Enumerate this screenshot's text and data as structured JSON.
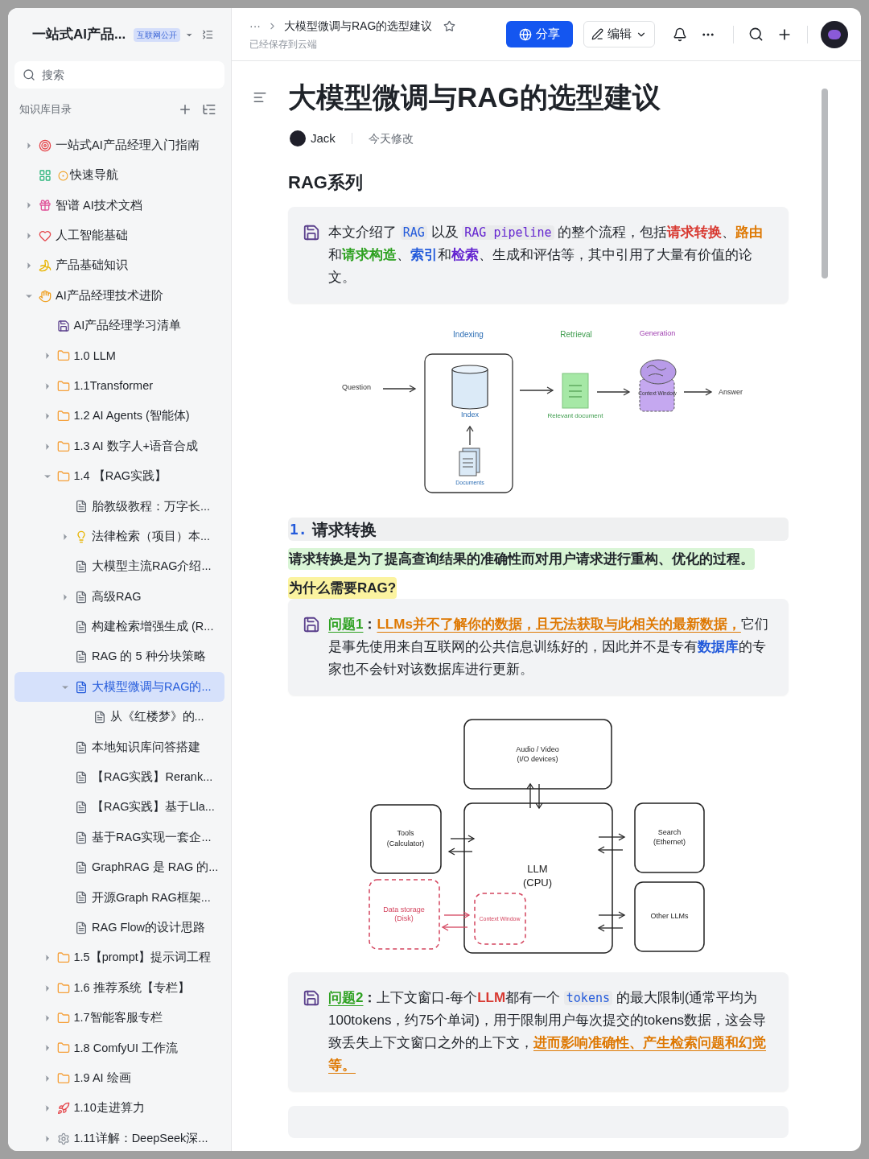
{
  "sidebar": {
    "space_title": "一站式AI产品...",
    "badge": "互联网公开",
    "search": {
      "placeholder": "搜索"
    },
    "section_label": "知识库目录",
    "items": [
      {
        "label": "一站式AI产品经理入门指南",
        "kind": "target",
        "expanded": false
      },
      {
        "label": "快速导航",
        "kind": "app",
        "prefix_icon": true
      },
      {
        "label": "智谱 AI技术文档",
        "kind": "gift",
        "expanded": false
      },
      {
        "label": "人工智能基础",
        "kind": "heart",
        "expanded": false
      },
      {
        "label": "产品基础知识",
        "kind": "banana",
        "expanded": false
      },
      {
        "label": "AI产品经理技术进阶",
        "kind": "hand",
        "expanded": true,
        "children": [
          {
            "label": "AI产品经理学习清单",
            "kind": "save"
          },
          {
            "label": "1.0 LLM",
            "kind": "folder",
            "expanded": false
          },
          {
            "label": "1.1Transformer",
            "kind": "folder",
            "expanded": false
          },
          {
            "label": "1.2 AI Agents (智能体)",
            "kind": "folder",
            "expanded": false
          },
          {
            "label": "1.3 AI 数字人+语音合成",
            "kind": "folder",
            "expanded": false
          },
          {
            "label": "1.4 【RAG实践】",
            "kind": "folder",
            "expanded": true,
            "children": [
              {
                "label": "胎教级教程：万字长...",
                "kind": "doc"
              },
              {
                "label": "法律检索（项目）本...",
                "kind": "bulb",
                "expanded": false
              },
              {
                "label": "大模型主流RAG介绍...",
                "kind": "doc"
              },
              {
                "label": "高级RAG",
                "kind": "doc",
                "expanded": false
              },
              {
                "label": "构建检索增强生成 (R...",
                "kind": "doc"
              },
              {
                "label": "RAG 的 5 种分块策略",
                "kind": "doc"
              },
              {
                "label": "大模型微调与RAG的...",
                "kind": "doc",
                "selected": true,
                "expanded": true,
                "children": [
                  {
                    "label": "从《红楼梦》的...",
                    "kind": "doc"
                  }
                ]
              },
              {
                "label": "本地知识库问答搭建",
                "kind": "doc"
              },
              {
                "label": "【RAG实践】Rerank...",
                "kind": "doc"
              },
              {
                "label": "【RAG实践】基于Lla...",
                "kind": "doc"
              },
              {
                "label": "基于RAG实现一套企...",
                "kind": "doc"
              },
              {
                "label": "GraphRAG 是 RAG 的...",
                "kind": "doc"
              },
              {
                "label": "开源Graph RAG框架...",
                "kind": "doc"
              },
              {
                "label": "RAG Flow的设计思路",
                "kind": "doc"
              }
            ]
          },
          {
            "label": "1.5【prompt】提示词工程",
            "kind": "folder",
            "expanded": false
          },
          {
            "label": "1.6 推荐系统【专栏】",
            "kind": "folder",
            "expanded": false
          },
          {
            "label": "1.7智能客服专栏",
            "kind": "folder",
            "expanded": false
          },
          {
            "label": "1.8 ComfyUI 工作流",
            "kind": "folder",
            "expanded": false
          },
          {
            "label": "1.9 AI 绘画",
            "kind": "folder",
            "expanded": false
          },
          {
            "label": "1.10走进算力",
            "kind": "rocket",
            "expanded": false
          },
          {
            "label": "1.11详解：DeepSeek深...",
            "kind": "gear",
            "expanded": false
          }
        ]
      }
    ]
  },
  "header": {
    "more": "···",
    "breadcrumb": "大模型微调与RAG的选型建议",
    "starred": false,
    "save_status": "已经保存到云端",
    "share_button": "分享",
    "edit_button": "编辑"
  },
  "document": {
    "title": "大模型微调与RAG的选型建议",
    "author": "Jack",
    "modified": "今天修改",
    "blocks": [
      {
        "kind": "h2",
        "text": "RAG系列"
      },
      {
        "kind": "callout",
        "segments": [
          {
            "kind": "text",
            "text": "本文介绍了 "
          },
          {
            "kind": "code",
            "text": "RAG",
            "color": "#245bdb"
          },
          {
            "kind": "text",
            "text": " 以及 "
          },
          {
            "kind": "code",
            "text": "RAG pipeline",
            "color": "#6425d0"
          },
          {
            "kind": "text",
            "text": " 的整个流程，包括"
          },
          {
            "kind": "strong",
            "text": "请求转换",
            "color": "#d83931"
          },
          {
            "kind": "text",
            "text": "、"
          },
          {
            "kind": "strong",
            "text": "路由",
            "color": "#de7802"
          },
          {
            "kind": "text",
            "text": "和"
          },
          {
            "kind": "strong",
            "text": "请求构造",
            "color": "#2ea121"
          },
          {
            "kind": "text",
            "text": "、"
          },
          {
            "kind": "strong",
            "text": "索引",
            "color": "#245bdb"
          },
          {
            "kind": "text",
            "text": "和"
          },
          {
            "kind": "strong",
            "text": "检索",
            "color": "#6425d0"
          },
          {
            "kind": "text",
            "text": "、生成和评估等，其中引用了大量有价值的论文。"
          }
        ]
      },
      {
        "kind": "rag_diagram",
        "labels": {
          "indexing": "Indexing",
          "retrieval": "Retrieval",
          "generation": "Generation",
          "question": "Question",
          "index": "Index",
          "documents": "Documents",
          "relevant": "Relevant document",
          "context": "Context Window",
          "answer": "Answer"
        }
      },
      {
        "kind": "h3",
        "number": "1.",
        "text": "请求转换"
      },
      {
        "kind": "highlight",
        "color": "#d9f5d6",
        "text": "请求转换是为了提高查询结果的准确性而对用户请求进行重构、优化的过程。"
      },
      {
        "kind": "highlight",
        "color": "#fbf3a0",
        "text": "为什么需要RAG?"
      },
      {
        "kind": "callout",
        "segments": [
          {
            "kind": "link",
            "text": "问题1",
            "color": "#2ea121"
          },
          {
            "kind": "strong",
            "text": "：",
            "color": "#1f2329"
          },
          {
            "kind": "link",
            "text": "LLMs并不了解你的数据，且无法获取与此相关的最新数据，",
            "color": "#de7802"
          },
          {
            "kind": "text",
            "text": "它们是事先使用来自互联网的公共信息训练好的，因此并不是专有"
          },
          {
            "kind": "strong",
            "text": "数据库",
            "color": "#245bdb"
          },
          {
            "kind": "text",
            "text": "的专家也不会针对该数据库进行更新。"
          }
        ]
      },
      {
        "kind": "llm_diagram",
        "labels": {
          "audio": "Audio / Video",
          "io": "(I/O devices)",
          "tools": "Tools",
          "calculator": "(Calculator)",
          "llm": "LLM",
          "cpu": "(CPU)",
          "search": "Search",
          "ethernet": "(Ethernet)",
          "storage": "Data storage",
          "disk": "(Disk)",
          "context": "Context Window",
          "other": "Other LLMs"
        }
      },
      {
        "kind": "callout",
        "segments": [
          {
            "kind": "link",
            "text": "问题2",
            "color": "#2ea121"
          },
          {
            "kind": "strong",
            "text": "：",
            "color": "#1f2329"
          },
          {
            "kind": "text",
            "text": "上下文窗口-每个"
          },
          {
            "kind": "strong",
            "text": "LLM",
            "color": "#d83931"
          },
          {
            "kind": "text",
            "text": "都有一个 "
          },
          {
            "kind": "code",
            "text": "tokens",
            "color": "#245bdb"
          },
          {
            "kind": "text",
            "text": " 的最大限制(通常平均为100tokens，约75个单词)，用于限制用户每次提交的tokens数据，这会导致丢失上下文窗口之外的上下文，"
          },
          {
            "kind": "link",
            "text": "进而影响准确性、产生检索问题和幻觉等。",
            "color": "#de7802"
          }
        ]
      },
      {
        "kind": "partial_callout"
      }
    ]
  }
}
